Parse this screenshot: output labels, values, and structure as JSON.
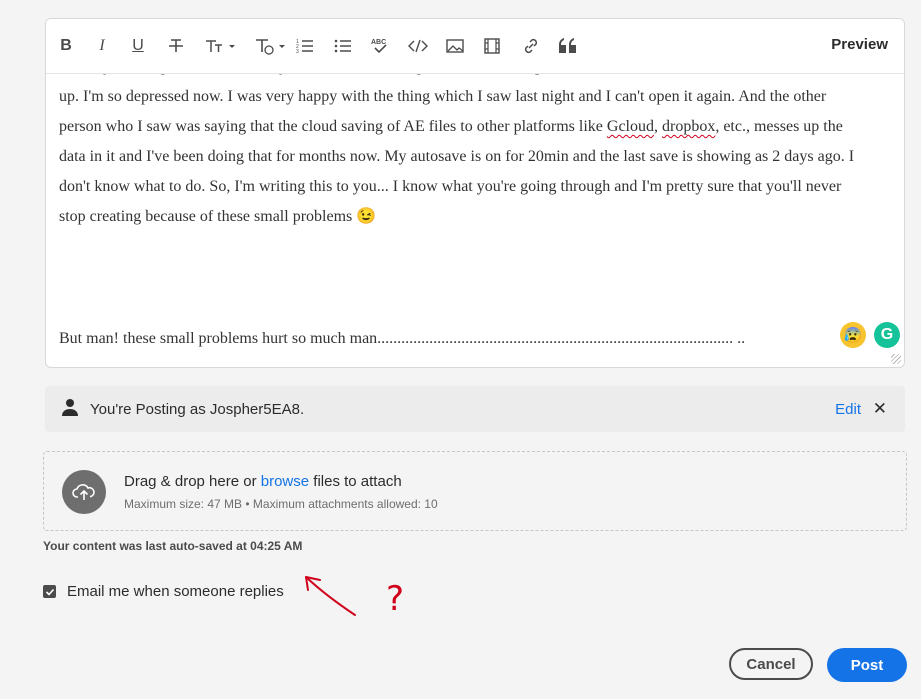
{
  "toolbar": {
    "buttons": [
      {
        "name": "bold-button",
        "glyph": "B"
      },
      {
        "name": "italic-button",
        "glyph": "I"
      },
      {
        "name": "underline-button",
        "glyph": "U"
      },
      {
        "name": "strikethrough-button",
        "glyph": "S"
      }
    ],
    "preview_label": "Preview"
  },
  "editor": {
    "cut_line": "... ... ...y ... ... ...g ... ... ... ... ... ... ...y ... ... ... ... ... ... ... ...g ... ... ... ... ... ... ...p",
    "paragraph_parts": {
      "p1": "up. I'm so depressed now. I was very happy with the thing which I saw last night and I can't open it again. And the other person who I saw was saying that the cloud saving of AE files to other platforms like ",
      "gcloud": "Gcloud",
      "sep": ", ",
      "dropbox": "dropbox",
      "p2": ", etc., messes up the data in it and I've been doing that for months now. My autosave is on for 20min and the last save is showing as 2 days ago. I don't know what to do. So, I'm writing this to you... I know what you're going through and I'm pretty sure that you'll never stop creating because of these small problems ",
      "wink": "😉"
    },
    "tail_line": "But man! these small problems hurt so much man.........................................................................................  ..",
    "emoji": "😰",
    "grammarly_letter": "G"
  },
  "posting": {
    "text": "You're Posting as Jospher5EA8.",
    "edit_label": "Edit",
    "close_glyph": "✕"
  },
  "attach": {
    "prefix": "Drag & drop here or ",
    "browse_label": "browse",
    "suffix": " files to attach",
    "limits": "Maximum size: 47 MB • Maximum attachments allowed: 10"
  },
  "autosave_text": "Your content was last auto-saved at 04:25 AM",
  "email_option": {
    "label": "Email me when someone replies",
    "checked": true
  },
  "annotation": {
    "mark": "?",
    "color": "#d0021b"
  },
  "actions": {
    "cancel_label": "Cancel",
    "post_label": "Post"
  },
  "colors": {
    "accent": "#1473e6",
    "annotation": "#d0021b",
    "grammarly": "#15c39a"
  }
}
